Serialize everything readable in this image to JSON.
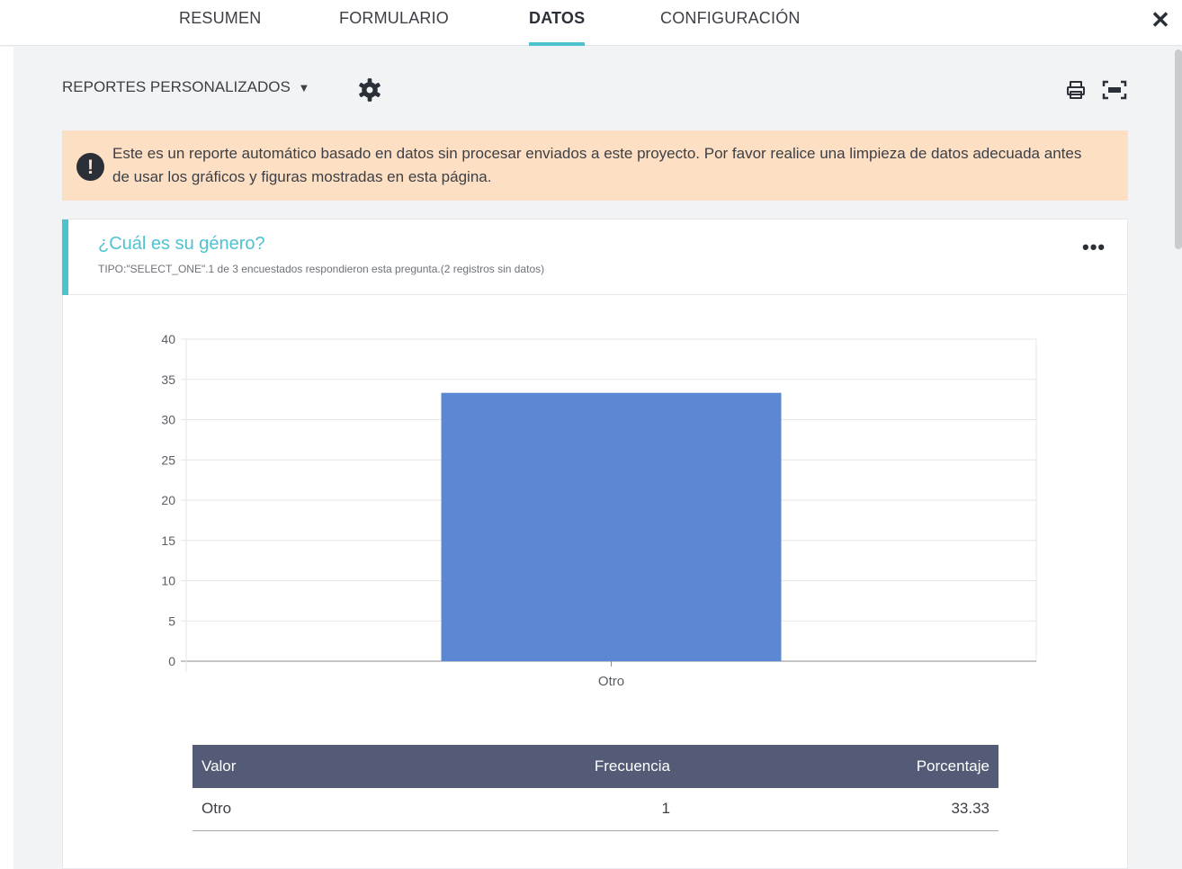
{
  "tabs": [
    {
      "label": "RESUMEN",
      "active": false
    },
    {
      "label": "FORMULARIO",
      "active": false
    },
    {
      "label": "DATOS",
      "active": true
    },
    {
      "label": "CONFIGURACIÓN",
      "active": false
    }
  ],
  "close_icon": "close-icon",
  "toolbar": {
    "reports_label": "REPORTES PERSONALIZADOS",
    "dropdown_caret": "▼",
    "settings_icon": "gear-icon",
    "print_icon": "print-icon",
    "expand_icon": "expand-icon"
  },
  "warning": {
    "icon": "exclamation-icon",
    "glyph": "!",
    "text": "Este es un reporte automático basado en datos sin procesar enviados a este proyecto. Por favor realice una limpieza de datos adecuada antes de usar los gráficos y figuras mostradas en esta página."
  },
  "question": {
    "title": "¿Cuál es su género?",
    "meta": "TIPO:\"SELECT_ONE\".1 de 3 encuestados respondieron esta pregunta.(2 registros sin datos)",
    "more_icon": "more-icon",
    "more_glyph": "•••"
  },
  "chart_data": {
    "type": "bar",
    "categories": [
      "Otro"
    ],
    "values": [
      33.33
    ],
    "yticks": [
      0,
      5,
      10,
      15,
      20,
      25,
      30,
      35,
      40
    ],
    "ylim": [
      0,
      40
    ],
    "grid": true,
    "legend": false,
    "bar_color": "#5b87d3"
  },
  "table": {
    "headers": {
      "value": "Valor",
      "frequency": "Frecuencia",
      "percentage": "Porcentaje"
    },
    "rows": [
      {
        "value": "Otro",
        "frequency": "1",
        "percentage": "33.33"
      }
    ]
  },
  "colors": {
    "accent": "#4ec3d0",
    "warning_bg": "#fde0c3",
    "table_header": "#545b76"
  }
}
